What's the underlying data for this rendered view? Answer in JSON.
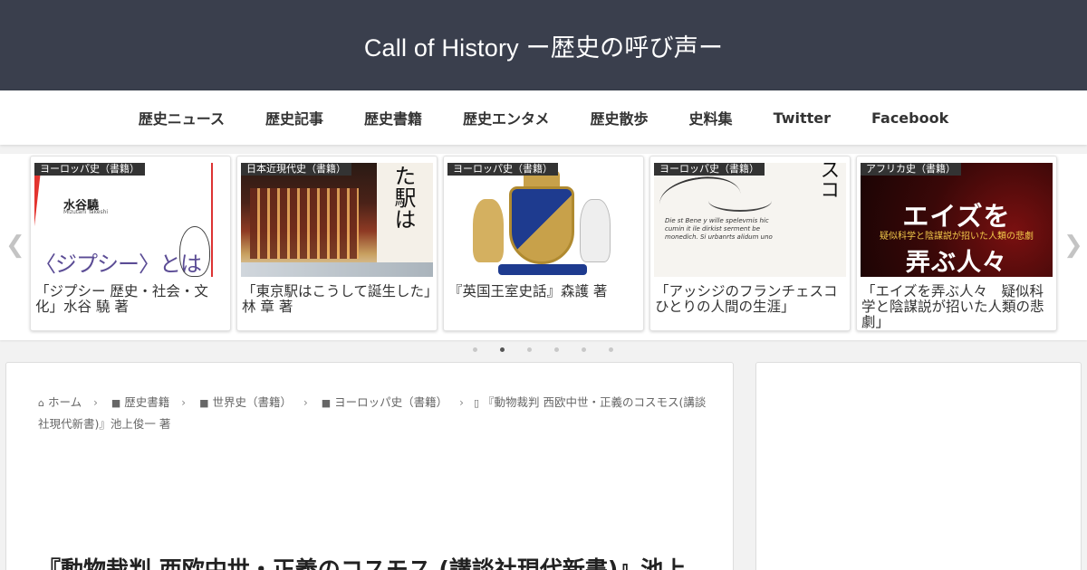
{
  "header": {
    "title": "Call of History ー歴史の呼び声ー",
    "bg_color": "#3a3f4d"
  },
  "nav": {
    "items": [
      {
        "label": "歴史ニュース"
      },
      {
        "label": "歴史記事"
      },
      {
        "label": "歴史書籍"
      },
      {
        "label": "歴史エンタメ"
      },
      {
        "label": "歴史散歩"
      },
      {
        "label": "史料集"
      },
      {
        "label": "Twitter"
      },
      {
        "label": "Facebook"
      }
    ]
  },
  "carousel": {
    "prev_icon": "chevron-left-icon",
    "next_icon": "chevron-right-icon",
    "cards": [
      {
        "category": "ヨーロッパ史（書籍）",
        "title": "「ジプシー 歴史・社会・文化」水谷 驍 著",
        "thumb_text": "水谷驍",
        "thumb_sub": "Mizutani Takeshi",
        "thumb_big": "〈ジプシー〉とは"
      },
      {
        "category": "日本近現代史（書籍）",
        "title": "「東京駅はこうして誕生した」林 章 著",
        "thumb_text": "た駅は"
      },
      {
        "category": "ヨーロッパ史（書籍）",
        "title": "『英国王室史話』森護 著"
      },
      {
        "category": "ヨーロッパ史（書籍）",
        "title": "「アッシジのフランチェスコ　ひとりの人間の生涯」",
        "thumb_text": "ノランチェスコ",
        "thumb_script": "Die st Bene y wille spelevmis hic cumin it ile dirkist serment be monedich. Si urbanrts alidum uno"
      },
      {
        "category": "アフリカ史（書籍）",
        "title": "「エイズを弄ぶ人々　疑似科学と陰謀説が招いた人類の悲劇」",
        "thumb_h1": "エイズを",
        "thumb_sub": "疑似科学と陰謀説が招いた人類の悲劇",
        "thumb_h2": "弄ぶ人々"
      }
    ],
    "dots": {
      "count": 6,
      "active": 1
    }
  },
  "breadcrumb": {
    "items": [
      {
        "icon": "home-icon",
        "label": "ホーム"
      },
      {
        "icon": "folder-icon",
        "label": "歴史書籍"
      },
      {
        "icon": "folder-icon",
        "label": "世界史（書籍）"
      },
      {
        "icon": "folder-icon",
        "label": "ヨーロッパ史（書籍）"
      },
      {
        "icon": "file-icon",
        "label": "『動物裁判 西欧中世・正義のコスモス(講談社現代新書)』池上俊一 著"
      }
    ]
  },
  "article": {
    "title": "『動物裁判 西欧中世・正義のコスモス (講談社現代新書)』池上"
  }
}
